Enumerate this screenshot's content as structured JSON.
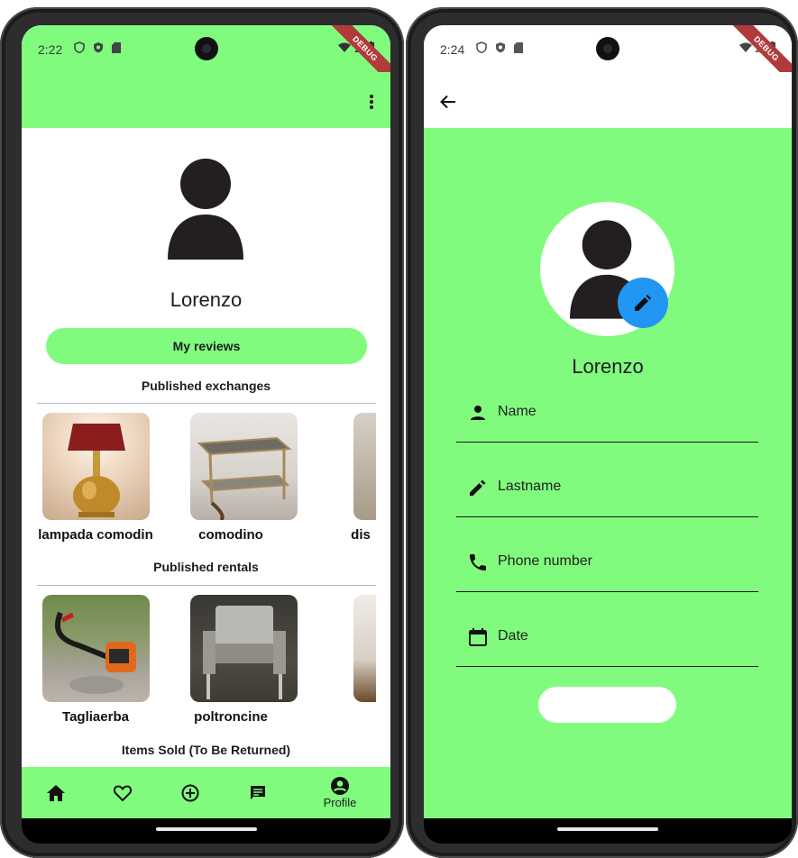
{
  "colors": {
    "accent_green": "#80fb7e",
    "fab_blue": "#2196f3"
  },
  "left_screen": {
    "status": {
      "time": "2:22",
      "debug_badge": "DEBUG"
    },
    "appbar": {
      "menu_icon": "more-vert-icon"
    },
    "profile": {
      "username": "Lorenzo",
      "reviews_button": "My reviews"
    },
    "sections": [
      {
        "title": "Published exchanges",
        "items": [
          {
            "label": "lampada comodin"
          },
          {
            "label": "comodino"
          },
          {
            "label": "dis"
          }
        ]
      },
      {
        "title": "Published rentals",
        "items": [
          {
            "label": "Tagliaerba"
          },
          {
            "label": "poltroncine"
          },
          {
            "label": ""
          }
        ]
      },
      {
        "title": "Items Sold (To Be Returned)",
        "items": []
      }
    ],
    "bottom_nav": [
      {
        "icon": "home-icon",
        "label": ""
      },
      {
        "icon": "heart-icon",
        "label": ""
      },
      {
        "icon": "add-circle-icon",
        "label": ""
      },
      {
        "icon": "chat-icon",
        "label": ""
      },
      {
        "icon": "account-circle-icon",
        "label": "Profile"
      }
    ]
  },
  "right_screen": {
    "status": {
      "time": "2:24",
      "debug_badge": "DEBUG"
    },
    "appbar": {
      "back_icon": "arrow-back-icon"
    },
    "profile": {
      "username": "Lorenzo"
    },
    "form": {
      "name_placeholder": "Name",
      "lastname_placeholder": "Lastname",
      "phone_placeholder": "Phone number",
      "date_placeholder": "Date",
      "save_label": ""
    }
  }
}
